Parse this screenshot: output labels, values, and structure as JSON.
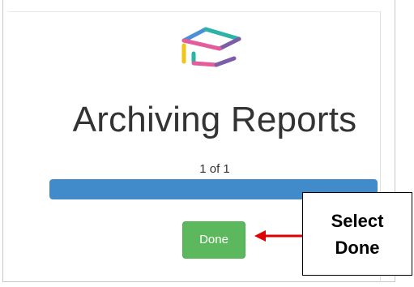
{
  "title": "Archiving Reports",
  "progress": {
    "counter_text": "1 of 1",
    "fraction": 1.0,
    "color": "#428bca"
  },
  "done_button": {
    "label": "Done",
    "color": "#5cb85c"
  },
  "callout": {
    "line1": "Select",
    "line2": "Done"
  },
  "logo": {
    "icon": "graduation-cap-logo-icon",
    "colors": [
      "#4a90d9",
      "#2ab3a6",
      "#f0c419",
      "#e55c9c",
      "#7b5ea7"
    ]
  },
  "annotation_arrow_color": "#e00000"
}
